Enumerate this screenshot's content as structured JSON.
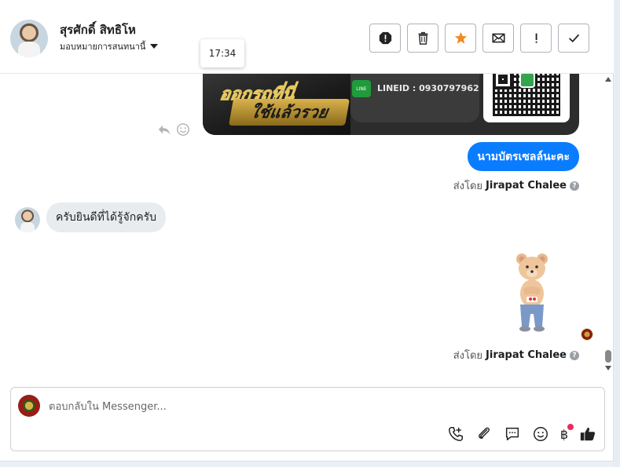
{
  "header": {
    "name": "สุรศักดิ์ สิทธิโห",
    "subtitle": "มอบหมายการสนทนานี้",
    "tooltip_time": "17:34",
    "actions": [
      "spam-icon",
      "trash-icon",
      "star-icon",
      "envelope-icon",
      "exclamation-icon",
      "check-icon"
    ],
    "accent_star": "#f08a24"
  },
  "chat": {
    "card": {
      "title_line1": "ออกรถที่นี่",
      "title_line2": "ใช้แล้วรวย",
      "line_badge": "LINE",
      "line_id": "LINEID : 0930797962"
    },
    "outgoing_text": "นามบัตรเซลล์นะคะ",
    "outgoing_color": "#0a7cff",
    "sender_prefix": "ส่งโดย",
    "sender_name": "Jirapat Chalee",
    "incoming_text": "ครับยินดีที่ได้รู้จักครับ",
    "sender2_prefix": "ส่งโดย",
    "sender2_name": "Jirapat Chalee"
  },
  "composer": {
    "placeholder": "ตอบกลับใน Messenger...",
    "tools": [
      "call-add-icon",
      "attach-icon",
      "comment-icon",
      "emoji-icon",
      "baht-icon",
      "like-icon"
    ],
    "baht_symbol": "฿"
  }
}
